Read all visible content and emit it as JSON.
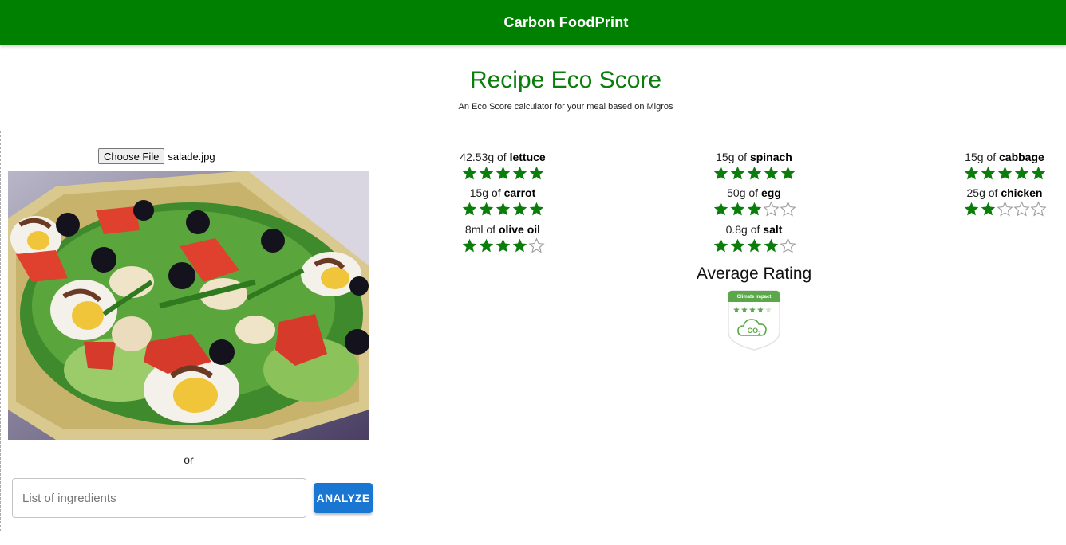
{
  "app": {
    "title": "Carbon FoodPrint"
  },
  "header": {
    "title": "Recipe Eco Score",
    "subtitle": "An Eco Score calculator for your meal based on Migros"
  },
  "upload": {
    "choose_file_label": "Choose File",
    "file_name": "salade.jpg",
    "or_label": "or",
    "input_placeholder": "List of ingredients",
    "input_value": "",
    "analyze_label": "ANALYZE"
  },
  "ingredients": [
    {
      "quantity": "42.53g of",
      "name": "lettuce",
      "rating": 5
    },
    {
      "quantity": "15g of",
      "name": "spinach",
      "rating": 5
    },
    {
      "quantity": "15g of",
      "name": "cabbage",
      "rating": 5
    },
    {
      "quantity": "15g of",
      "name": "carrot",
      "rating": 5
    },
    {
      "quantity": "50g of",
      "name": "egg",
      "rating": 3
    },
    {
      "quantity": "25g of",
      "name": "chicken",
      "rating": 2
    },
    {
      "quantity": "8ml of",
      "name": "olive oil",
      "rating": 4
    },
    {
      "quantity": "0.8g of",
      "name": "salt",
      "rating": 4
    }
  ],
  "rating_max": 5,
  "average": {
    "title": "Average Rating",
    "badge_header": "Climate impact",
    "badge_rating": 4,
    "badge_icon": "co2-cloud-icon",
    "badge_co2": "CO2"
  },
  "colors": {
    "brand_green": "#008000",
    "star_green": "#0a7d0a",
    "button_blue": "#1976d2",
    "badge_green": "#5aa84a"
  }
}
